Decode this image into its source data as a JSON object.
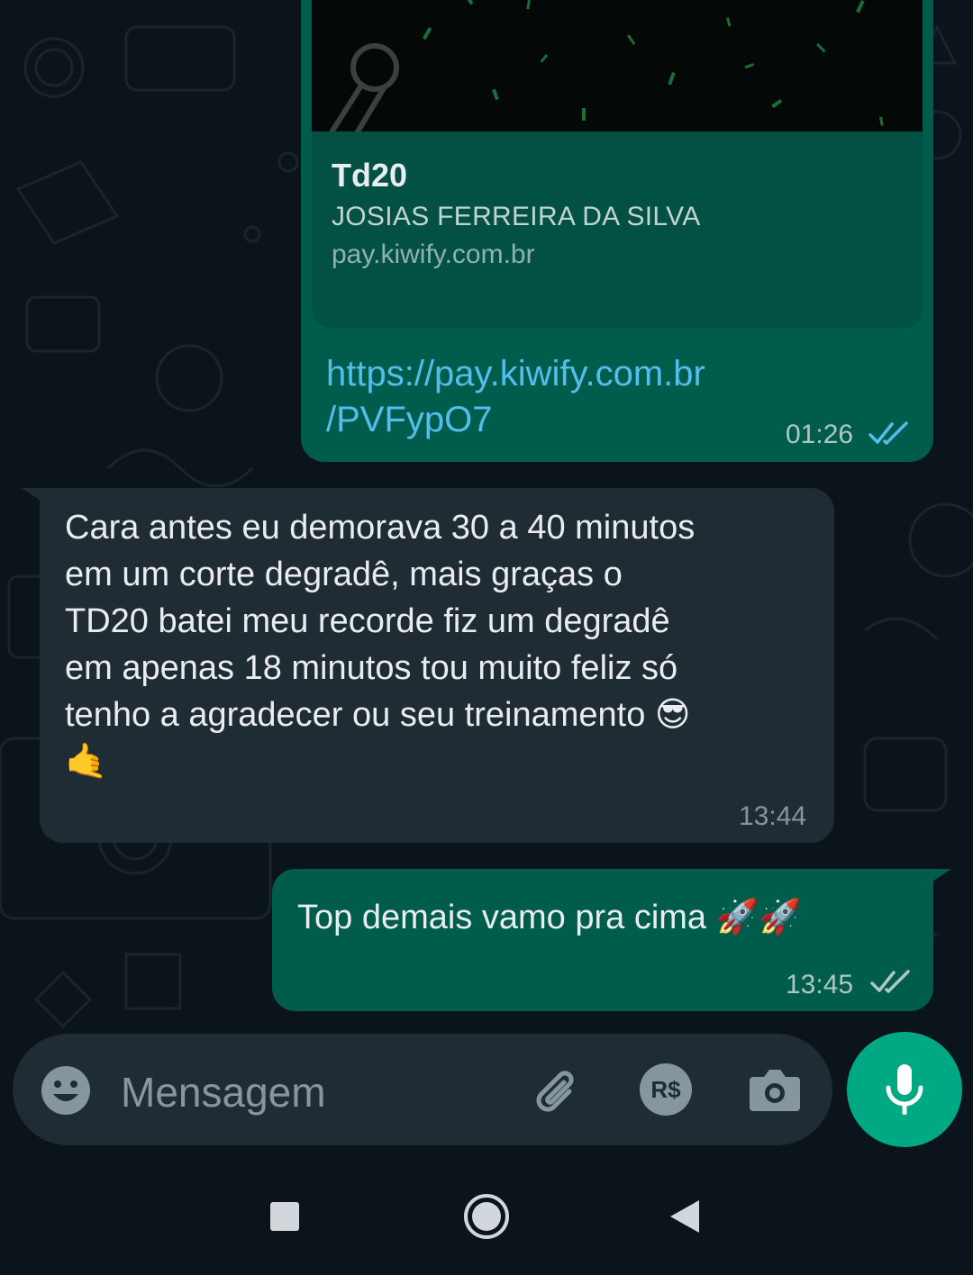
{
  "chat": {
    "link_message": {
      "preview_title": "Td20",
      "preview_subtitle": "JOSIAS FERREIRA DA SILVA",
      "preview_domain": "pay.kiwify.com.br",
      "link_line1": "https://pay.kiwify.com.br",
      "link_line2": "/PVFypO7",
      "time": "01:26",
      "status": "read"
    },
    "incoming_message": {
      "text": "Cara antes eu demorava 30 a 40 minutos\nem um corte degradê, mais graças o\nTD20 batei meu recorde fiz um degradê\nem apenas 18 minutos tou muito feliz só\ntenho a agradecer ou seu treinamento 😎\n🤙",
      "time": "13:44"
    },
    "outgoing_message": {
      "text": "Top demais vamo pra cima 🚀🚀",
      "time": "13:45",
      "status": "read"
    }
  },
  "composer": {
    "placeholder": "Mensagem",
    "emoji_icon": "emoji-icon",
    "attach_icon": "paperclip-icon",
    "payment_label": "R$",
    "camera_icon": "camera-icon",
    "mic_icon": "microphone-icon"
  },
  "navigation": {
    "recents": "square-icon",
    "home": "circle-icon",
    "back": "triangle-back-icon"
  },
  "colors": {
    "background": "#0b141a",
    "outgoing_bubble": "#005c4b",
    "incoming_bubble": "#202c33",
    "link": "#53bdeb",
    "read_ticks": "#53bdeb",
    "accent": "#00a884"
  }
}
